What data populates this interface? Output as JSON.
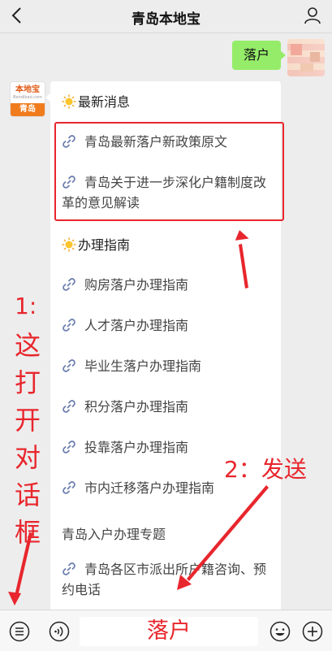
{
  "header": {
    "title": "青岛本地宝"
  },
  "outgoing": {
    "text": "落户"
  },
  "bot": {
    "brand": "本地宝",
    "brand_sub": "Bendibao.com",
    "city": "青岛"
  },
  "card": {
    "section1_title": "最新消息",
    "section1_items": [
      "青岛最新落户新政策原文",
      "青岛关于进一步深化户籍制度改革的意见解读"
    ],
    "section2_title": "办理指南",
    "section2_items": [
      "购房落户办理指南",
      "人才落户办理指南",
      "毕业生落户办理指南",
      "积分落户办理指南",
      "投靠落户办理指南",
      "市内迁移落户办理指南"
    ],
    "plain_item": "青岛入户办理专题",
    "last_item": "青岛各区市派出所户籍咨询、预约电话"
  },
  "annotations": {
    "label1": "1:",
    "label1_vertical": [
      "这",
      "打",
      "开",
      "对",
      "话",
      "框"
    ],
    "label2": "2：发送"
  },
  "input": {
    "value": "落户"
  },
  "colors": {
    "annotation": "#e8262d",
    "bubble": "#95ec69"
  },
  "icons": [
    "back-icon",
    "user-icon",
    "sun-icon",
    "link-icon",
    "menu-icon",
    "voice-icon",
    "emoji-icon",
    "plus-icon"
  ]
}
